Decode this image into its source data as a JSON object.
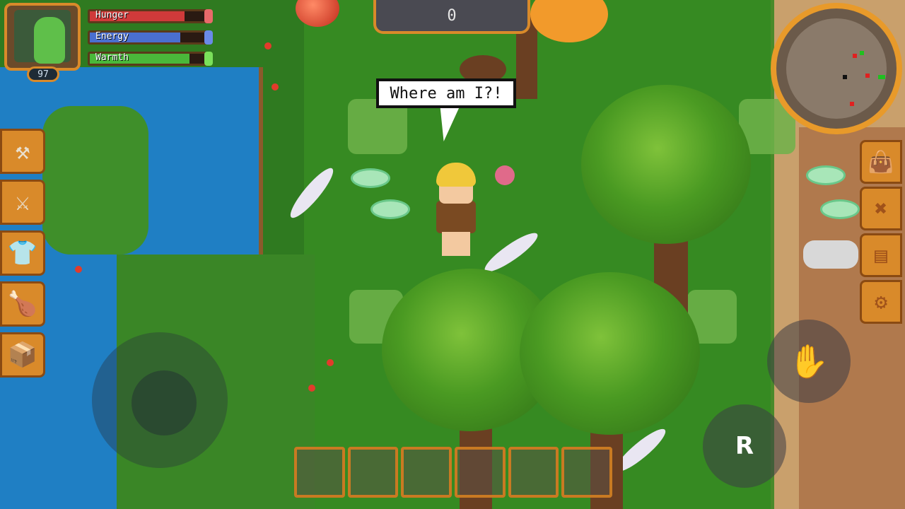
{
  "hud": {
    "level": "97",
    "bars": [
      {
        "label": "Hunger",
        "fill": 0.82,
        "color": "#d03a3a",
        "cap": "#e86a6a"
      },
      {
        "label": "Energy",
        "fill": 0.78,
        "color": "#4a6fd0",
        "cap": "#6a8ae8"
      },
      {
        "label": "Warmth",
        "fill": 0.86,
        "color": "#4ab83a",
        "cap": "#7ae05a"
      }
    ]
  },
  "score": {
    "value": "0"
  },
  "speech": {
    "text": "Where am I?!"
  },
  "tools": [
    {
      "name": "hammer",
      "icon": "hammer-icon",
      "glyph": "⚒"
    },
    {
      "name": "sword",
      "icon": "sword-icon",
      "glyph": "⚔"
    },
    {
      "name": "armor",
      "icon": "shirt-icon",
      "glyph": "👕"
    },
    {
      "name": "food",
      "icon": "food-icon",
      "glyph": "🍗"
    },
    {
      "name": "storage",
      "icon": "box-icon",
      "glyph": "📦"
    }
  ],
  "menu": [
    {
      "name": "inventory",
      "icon": "bag-icon",
      "glyph": "👜"
    },
    {
      "name": "crafting",
      "icon": "crossed-tools-icon",
      "glyph": "✖"
    },
    {
      "name": "journal",
      "icon": "book-icon",
      "glyph": "▤"
    },
    {
      "name": "settings",
      "icon": "gear-icon",
      "glyph": "⚙"
    }
  ],
  "controls": {
    "action_label": "R",
    "attack_icon": "hand-icon",
    "attack_glyph": "✋"
  },
  "hotbar": {
    "slots": 6
  },
  "colors": {
    "ui_orange": "#d98a2a",
    "grass": "#368a22",
    "water": "#1f7fc4"
  }
}
